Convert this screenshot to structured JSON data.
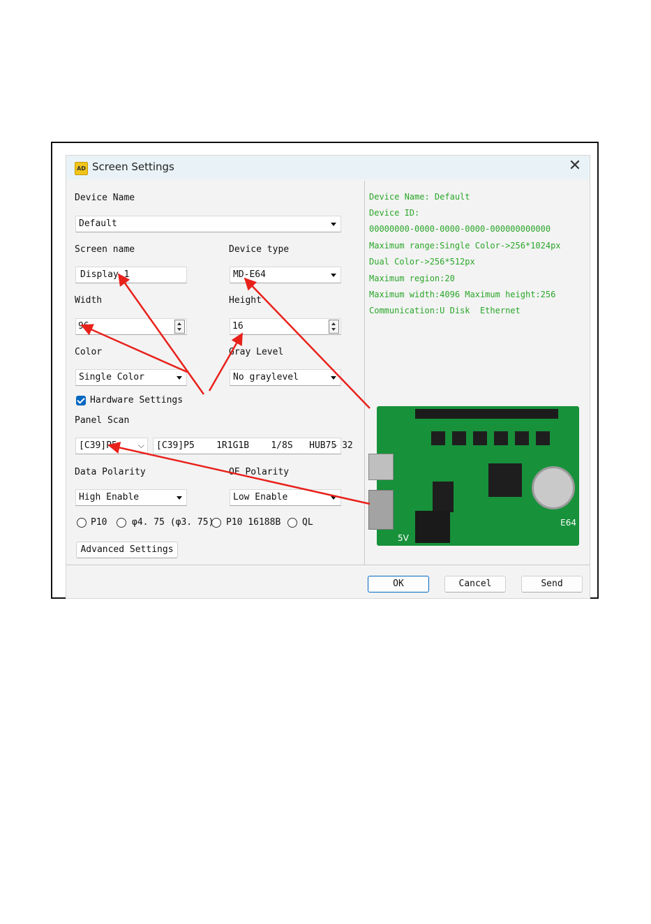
{
  "dialog": {
    "title": "Screen Settings",
    "app_icon_text": "AD"
  },
  "form": {
    "device_name_label": "Device Name",
    "device_name_value": "Default",
    "screen_name_label": "Screen name",
    "screen_name_value": "Display 1",
    "device_type_label": "Device type",
    "device_type_value": "MD-E64",
    "width_label": "Width",
    "width_value": "96",
    "height_label": "Height",
    "height_value": "16",
    "color_label": "Color",
    "color_value": "Single Color",
    "gray_level_label": "Gray Level",
    "gray_level_value": "No graylevel",
    "hardware_settings_label": "Hardware Settings",
    "hardware_settings_checked": true,
    "panel_scan_label": "Panel Scan",
    "panel_scan_value1": "[C39]P5",
    "panel_scan_value2": "[C39]P5    1R1G1B    1/8S   HUB75 32",
    "data_polarity_label": "Data Polarity",
    "data_polarity_value": "High Enable",
    "oe_polarity_label": "OE Polarity",
    "oe_polarity_value": "Low Enable",
    "radio_options": [
      "P10",
      "φ4. 75 (φ3. 75)",
      "P10 16188B",
      "QL"
    ],
    "advanced_button": "Advanced Settings"
  },
  "info": {
    "lines": [
      "Device Name: Default",
      "Device ID:",
      "00000000-0000-0000-0000-000000000000",
      "Maximum range:Single Color->256*1024px",
      "Dual Color->256*512px",
      "Maximum region:20",
      "Maximum width:4096 Maximum height:256",
      "Communication:U Disk  Ethernet"
    ],
    "color": "#2aa62a"
  },
  "board": {
    "label_model": "E64",
    "label_voltage": "5V"
  },
  "footer": {
    "ok": "OK",
    "cancel": "Cancel",
    "send": "Send"
  },
  "annotation_color": "#e8211b"
}
